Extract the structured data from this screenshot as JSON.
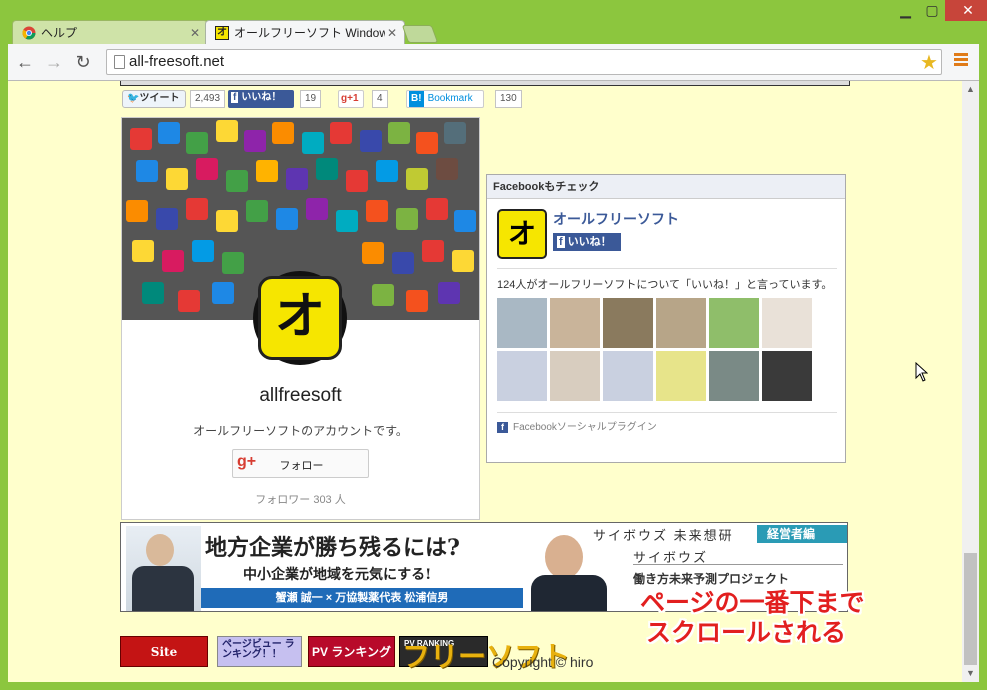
{
  "browser": {
    "tabs": [
      {
        "label": "ヘルプ",
        "icon": "chrome-icon",
        "active": false
      },
      {
        "label": "オールフリーソフト  Windows",
        "icon": "allfreesoft-favicon",
        "active": true
      }
    ],
    "url": "all-freesoft.net"
  },
  "social": {
    "tweet_label": "ツイート",
    "tweet_count": "2,493",
    "fb_label": "いいね！",
    "fb_count": "19",
    "gplus_label": "+1",
    "gplus_count": "4",
    "hatena_b": "B!",
    "hatena_label": "Bookmark",
    "hatena_count": "130"
  },
  "gplus_card": {
    "name": "allfreesoft",
    "description": "オールフリーソフトのアカウントです。",
    "follow_label": "フォロー",
    "followers": "フォロワー 303 人",
    "avatar_glyph": "オ"
  },
  "facebook_box": {
    "header": "Facebookもチェック",
    "page_name": "オールフリーソフト",
    "like_label": "いいね！",
    "likes_text": "124人がオールフリーソフトについて「いいね！」と言っています。",
    "plugin_label": "Facebookソーシャルプラグイン",
    "logo_glyph": "オ"
  },
  "ad": {
    "title": "地方企業が勝ち残るには?",
    "subtitle": "中小企業が地域を元気にする!",
    "names": "蟹瀬 誠一 × 万協製薬代表 松浦信男",
    "right_title": "サイボウズ 未来想研",
    "badge": "経営者編",
    "right_sub": "サイボウズ",
    "right_sub2": "働き方未来予測プロジェクト"
  },
  "ranking": {
    "site_ranking": "Site Ranking",
    "pageview": "ページビュー ランキング！！",
    "pv_label": "PV ランキング",
    "pv_ranking": "PV RANKING"
  },
  "footer": {
    "logo": "フリーソフト",
    "copyright": "Copyright © hiro"
  },
  "caption": {
    "line1": "ページの一番下まで",
    "line2": "スクロールされる"
  },
  "colors": {
    "frame": "#8cc63e",
    "page_bg": "#ffffcc",
    "fb_blue": "#3b5998",
    "caption_red": "#e21f1f"
  }
}
